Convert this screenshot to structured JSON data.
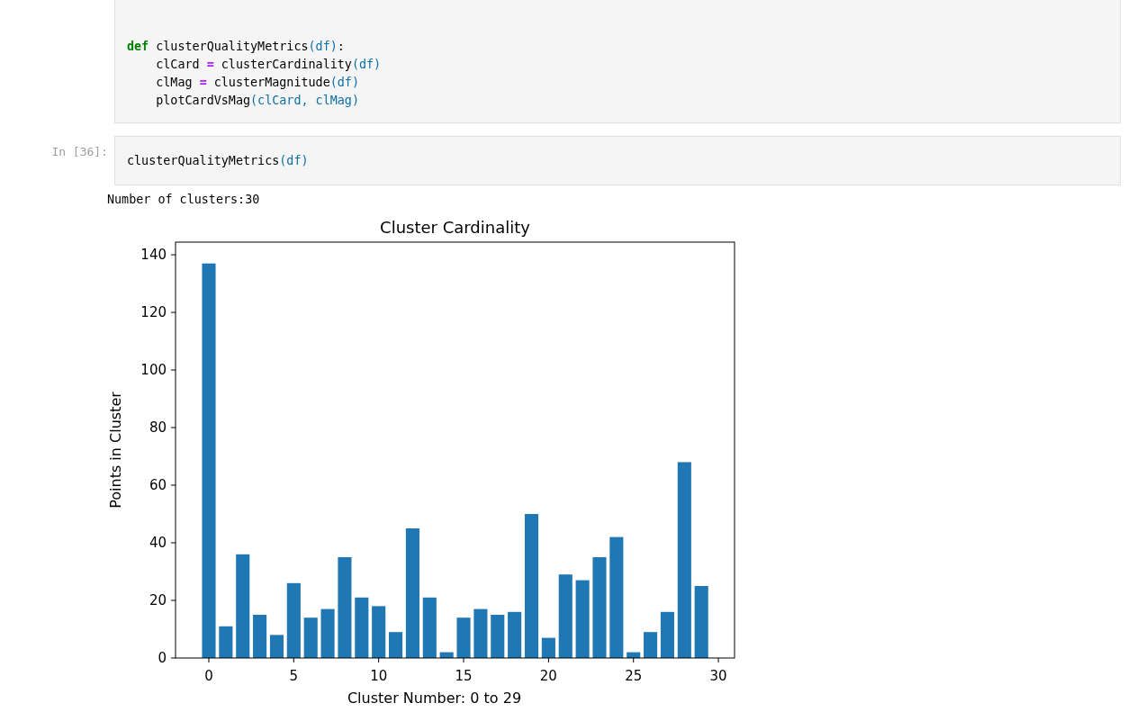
{
  "cells": [
    {
      "lines": [
        [
          {
            "kind": "keyword",
            "text": "def"
          },
          {
            "kind": "name",
            "text": " clusterQualityMetrics"
          },
          {
            "kind": "paren",
            "text": "(df)"
          },
          {
            "kind": "name",
            "text": ":"
          }
        ],
        [
          {
            "kind": "name",
            "text": "    clCard "
          },
          {
            "kind": "operator",
            "text": "="
          },
          {
            "kind": "name",
            "text": " clusterCardinality"
          },
          {
            "kind": "paren",
            "text": "(df)"
          }
        ],
        [
          {
            "kind": "name",
            "text": "    clMag "
          },
          {
            "kind": "operator",
            "text": "="
          },
          {
            "kind": "name",
            "text": " clusterMagnitude"
          },
          {
            "kind": "paren",
            "text": "(df)"
          }
        ],
        [
          {
            "kind": "name",
            "text": "    plotCardVsMag"
          },
          {
            "kind": "paren",
            "text": "(clCard, clMag)"
          }
        ]
      ]
    },
    {
      "prompt": "In [36]:",
      "lines": [
        [
          {
            "kind": "name",
            "text": "clusterQualityMetrics"
          },
          {
            "kind": "paren",
            "text": "(df)"
          }
        ]
      ],
      "output": {
        "text": "Number of clusters:30",
        "chart_data": {
          "type": "bar",
          "title": "Cluster Cardinality",
          "xlabel": "Cluster Number: 0 to 29",
          "ylabel": "Points in Cluster",
          "x": [
            0,
            1,
            2,
            3,
            4,
            5,
            6,
            7,
            8,
            9,
            10,
            11,
            12,
            13,
            14,
            15,
            16,
            17,
            18,
            19,
            20,
            21,
            22,
            23,
            24,
            25,
            26,
            27,
            28,
            29
          ],
          "series": [
            {
              "color": "#1f77b4",
              "values": [
                137,
                11,
                36,
                15,
                8,
                26,
                14,
                17,
                35,
                21,
                18,
                9,
                45,
                21,
                2,
                14,
                17,
                15,
                16,
                50,
                7,
                29,
                27,
                35,
                42,
                2,
                9,
                16,
                68,
                25
              ]
            }
          ],
          "xlim": [
            -1.96,
            30.95
          ],
          "ylim": [
            0,
            144.4
          ],
          "xticks": [
            0,
            5,
            10,
            15,
            20,
            25,
            30
          ],
          "yticks": [
            0,
            20,
            40,
            60,
            80,
            100,
            120,
            140
          ]
        }
      }
    }
  ]
}
